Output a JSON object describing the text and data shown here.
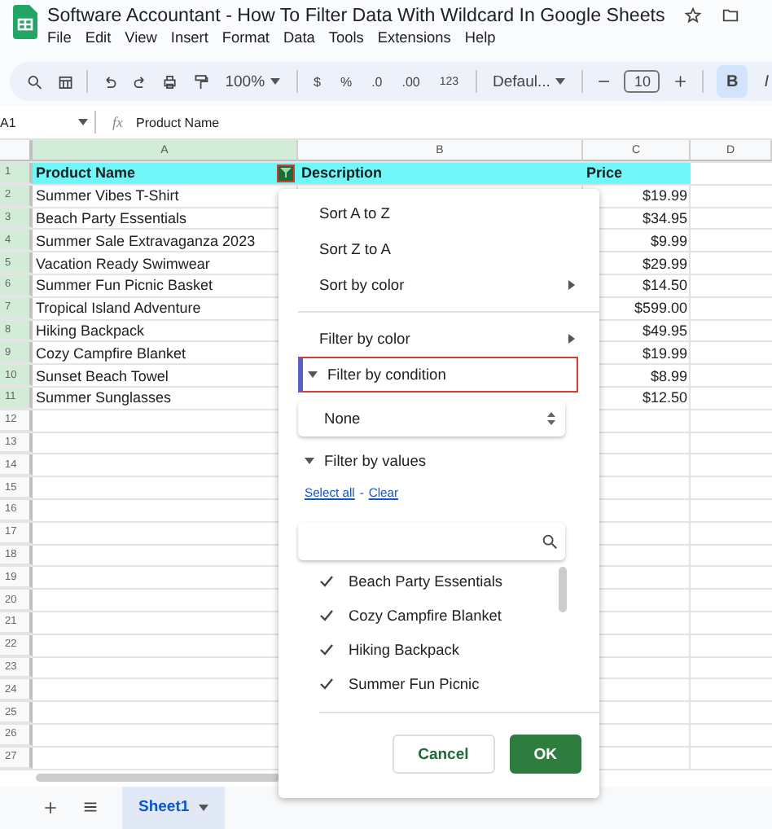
{
  "window": {
    "title": "Software Accountant - How To Filter Data With Wildcard In Google Sheets"
  },
  "menu_bar": [
    "File",
    "Edit",
    "View",
    "Insert",
    "Format",
    "Data",
    "Tools",
    "Extensions",
    "Help"
  ],
  "toolbar": {
    "zoom": "100%",
    "currency": "$",
    "percent": "%",
    "decrease_decimals": ".0",
    "increase_decimals": ".00",
    "number_format": "123",
    "font": "Defaul...",
    "font_size": "10",
    "bold": "B",
    "bold_active": true,
    "italic": "I"
  },
  "name_box": "A1",
  "formula_label": "fx",
  "formula": "Product Name",
  "columns": [
    {
      "label": "A",
      "selected": true
    },
    {
      "label": "B",
      "selected": false
    },
    {
      "label": "C",
      "selected": false
    },
    {
      "label": "D",
      "selected": false
    }
  ],
  "rows": [
    {
      "number": "1",
      "selected": true,
      "kind": "header",
      "product": "Product Name",
      "description": "Description",
      "price": "Price"
    },
    {
      "number": "2",
      "selected": true,
      "kind": "data",
      "product": "Summer Vibes T-Shirt",
      "price": "$19.99"
    },
    {
      "number": "3",
      "selected": true,
      "kind": "data",
      "product": "Beach Party Essentials",
      "price": "$34.95"
    },
    {
      "number": "4",
      "selected": true,
      "kind": "data",
      "product": "Summer Sale Extravaganza 2023",
      "price": "$9.99"
    },
    {
      "number": "5",
      "selected": true,
      "kind": "data",
      "product": "Vacation Ready Swimwear",
      "price": "$29.99"
    },
    {
      "number": "6",
      "selected": true,
      "kind": "data",
      "product": "Summer Fun Picnic Basket",
      "price": "$14.50"
    },
    {
      "number": "7",
      "selected": true,
      "kind": "data",
      "product": "Tropical Island Adventure",
      "price": "$599.00"
    },
    {
      "number": "8",
      "selected": true,
      "kind": "data",
      "product": "Hiking Backpack",
      "price": "$49.95"
    },
    {
      "number": "9",
      "selected": true,
      "kind": "data",
      "product": "Cozy Campfire Blanket",
      "price": "$19.99"
    },
    {
      "number": "10",
      "selected": true,
      "kind": "data",
      "product": "Sunset Beach Towel",
      "price": "$8.99"
    },
    {
      "number": "11",
      "selected": true,
      "kind": "data",
      "product": "Summer Sunglasses",
      "price": "$12.50"
    },
    {
      "number": "12",
      "selected": false,
      "kind": "data"
    },
    {
      "number": "13",
      "selected": false,
      "kind": "data"
    },
    {
      "number": "14",
      "selected": false,
      "kind": "data"
    },
    {
      "number": "15",
      "selected": false,
      "kind": "data"
    },
    {
      "number": "16",
      "selected": false,
      "kind": "data"
    },
    {
      "number": "17",
      "selected": false,
      "kind": "data"
    },
    {
      "number": "18",
      "selected": false,
      "kind": "data"
    },
    {
      "number": "19",
      "selected": false,
      "kind": "data"
    },
    {
      "number": "20",
      "selected": false,
      "kind": "data"
    },
    {
      "number": "21",
      "selected": false,
      "kind": "data"
    },
    {
      "number": "22",
      "selected": false,
      "kind": "data"
    },
    {
      "number": "23",
      "selected": false,
      "kind": "data"
    },
    {
      "number": "24",
      "selected": false,
      "kind": "data"
    },
    {
      "number": "25",
      "selected": false,
      "kind": "data"
    },
    {
      "number": "26",
      "selected": false,
      "kind": "data"
    },
    {
      "number": "27",
      "selected": false,
      "kind": "data"
    }
  ],
  "filter_menu": {
    "sort_items": [
      {
        "label": "Sort A to Z",
        "submenu": false
      },
      {
        "label": "Sort Z to A",
        "submenu": false
      },
      {
        "label": "Sort by color",
        "submenu": true
      }
    ],
    "filter_by_color": {
      "label": "Filter by color",
      "submenu": true
    },
    "filter_by_condition": {
      "label": "Filter by condition",
      "expanded": true,
      "highlighted": true,
      "value": "None"
    },
    "filter_by_values": {
      "label": "Filter by values",
      "expanded": true,
      "select_all": "Select all",
      "separator": "-",
      "clear": "Clear",
      "items": [
        {
          "label": "Beach Party Essentials",
          "checked": true
        },
        {
          "label": "Cozy Campfire Blanket",
          "checked": true
        },
        {
          "label": "Hiking Backpack",
          "checked": true
        },
        {
          "label": "Summer Fun Picnic",
          "checked": true
        }
      ]
    },
    "cancel": "Cancel",
    "ok": "OK"
  },
  "sheet_tabs": [
    {
      "label": "Sheet1",
      "selected": true
    }
  ]
}
